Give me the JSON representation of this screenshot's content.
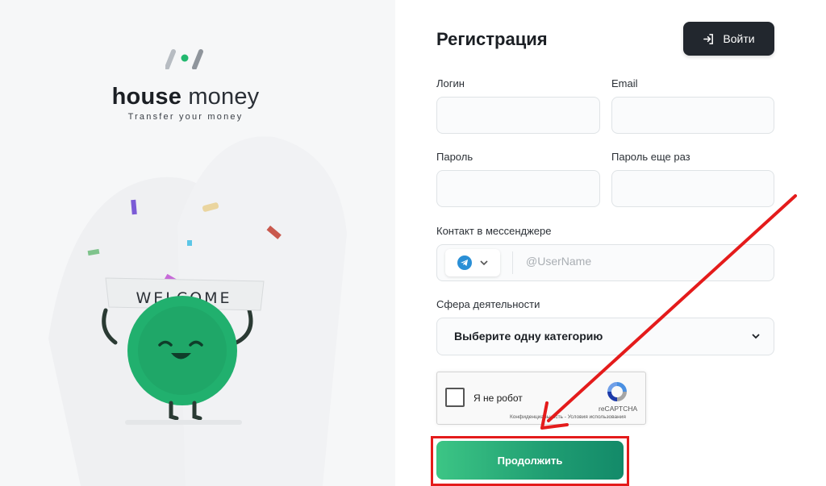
{
  "brand": {
    "name_bold": "house",
    "name_light": "money",
    "tagline": "Transfer your money"
  },
  "mascot": {
    "banner_text": "WELCOME"
  },
  "form": {
    "title": "Регистрация",
    "login_button_label": "Войти",
    "fields": {
      "login_label": "Логин",
      "email_label": "Email",
      "password_label": "Пароль",
      "password_repeat_label": "Пароль еще раз",
      "messenger_label": "Контакт в мессенджере",
      "messenger_placeholder": "@UserName",
      "messenger_icon": "telegram-icon",
      "activity_label": "Сфера деятельности",
      "activity_value": "Выберите одну категорию"
    },
    "captcha": {
      "label": "Я не робот",
      "brand": "reCAPTCHA",
      "terms": "Конфиденциальность - Условия использования"
    },
    "continue_button_label": "Продолжить"
  },
  "colors": {
    "accent_green": "#1f9d72",
    "dark_button": "#22272e",
    "highlight_red": "#e41b1b"
  }
}
